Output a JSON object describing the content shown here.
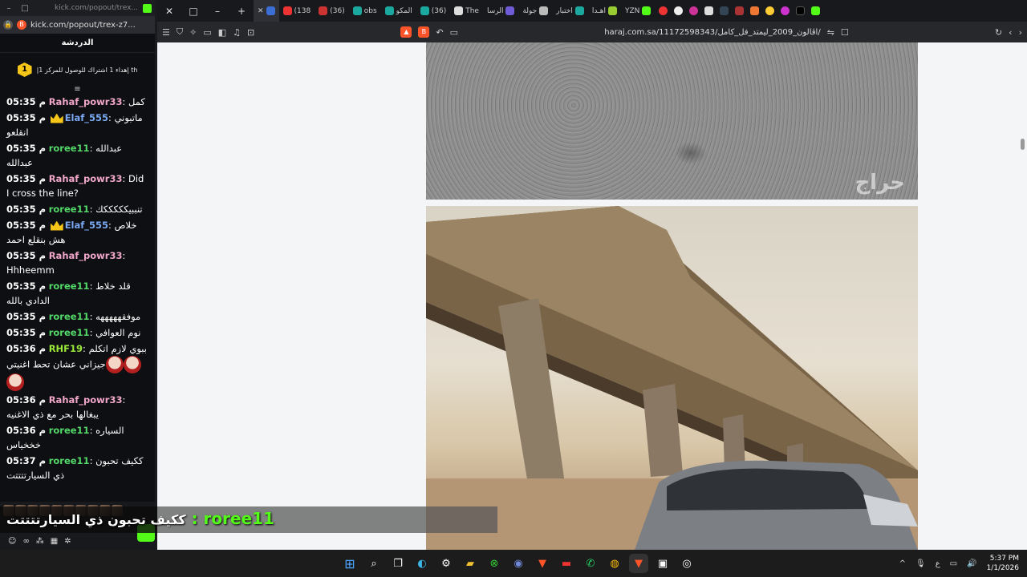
{
  "chat_window": {
    "url": "kick.com/popout/trex-z7...",
    "titlebar_url": "kick.com/popout/trex...",
    "header": "الدردشة",
    "pinned": {
      "badge": "1",
      "text": "|إهداء 1 اشتراك للوصول للمركز 1 th"
    },
    "messages": [
      {
        "time": "05:35 م",
        "user": "Rahaf_powr33",
        "color": "#f0a6c8",
        "text": ": كمل",
        "crown": false
      },
      {
        "time": "05:35 م",
        "user": "Elaf_555",
        "color": "#7aa9f5",
        "text": ": ماتبوني انقلعو",
        "crown": true
      },
      {
        "time": "05:35 م",
        "user": "roree11",
        "color": "#53d86a",
        "text": ": عبدالله عبدالله",
        "crown": false
      },
      {
        "time": "05:35 م",
        "user": "Rahaf_powr33",
        "color": "#f0a6c8",
        "text": ": Did I cross the line?",
        "crown": false
      },
      {
        "time": "05:35 م",
        "user": "roree11",
        "color": "#53d86a",
        "text": ": تنببيكككككك",
        "crown": false
      },
      {
        "time": "05:35 م",
        "user": "Elaf_555",
        "color": "#7aa9f5",
        "text": ": خلاص هش بنقلع احمد",
        "crown": true
      },
      {
        "time": "05:35 م",
        "user": "Rahaf_powr33",
        "color": "#f0a6c8",
        "text": ": Hhheemm",
        "crown": false
      },
      {
        "time": "05:35 م",
        "user": "roree11",
        "color": "#53d86a",
        "text": ": قلد خلاط الدادي بالله",
        "crown": false
      },
      {
        "time": "05:35 م",
        "user": "roree11",
        "color": "#53d86a",
        "text": ": موفقهههههه",
        "crown": false
      },
      {
        "time": "05:35 م",
        "user": "roree11",
        "color": "#53d86a",
        "text": ": نوم العوافي",
        "crown": false
      },
      {
        "time": "05:36 م",
        "user": "RHF19",
        "color": "#9bea3a",
        "text": ": ببوي لازم اتكلم جيزاني عشان تحط اغنيتي",
        "crown": false,
        "emotes": 3
      },
      {
        "time": "05:36 م",
        "user": "Rahaf_powr33",
        "color": "#f0a6c8",
        "text": ": يبغالها بحر مع ذي الاغنيه",
        "crown": false
      },
      {
        "time": "05:36 م",
        "user": "roree11",
        "color": "#53d86a",
        "text": ": السياره خخخياس",
        "crown": false
      },
      {
        "time": "05:37 م",
        "user": "roree11",
        "color": "#53d86a",
        "text": ": ككيف تحبون ذي السيارتتتتت",
        "crown": false
      }
    ]
  },
  "caption": {
    "user": "roree11",
    "sep": " : ",
    "text": "ككيف تحبون ذي السيارتتتتت"
  },
  "browser": {
    "tabs": [
      "The",
      "الرسا",
      "جولة",
      "اختبار",
      "اهـدا",
      "YZN",
      "(138",
      "(36)",
      "obs",
      "المكو",
      "(36)"
    ],
    "address": "haraj.com.sa/11172598343/اڤالون_2009_ليمتد_فل_كامل/",
    "watermark": "حراج"
  },
  "taskbar": {
    "time": "5:37 PM",
    "date": "1/1/2026",
    "lang": "ع"
  }
}
